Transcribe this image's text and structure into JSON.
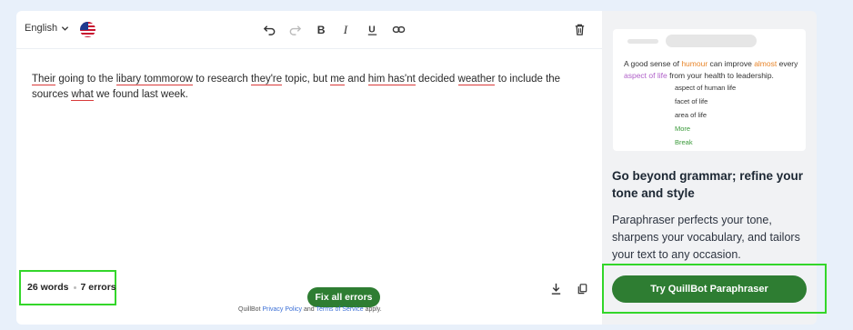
{
  "toolbar": {
    "language": "English",
    "language_flag": "us-flag-icon",
    "icons": [
      "undo-icon",
      "redo-icon",
      "bold-icon",
      "italic-icon",
      "underline-icon",
      "link-icon",
      "trash-icon"
    ]
  },
  "editor": {
    "segments": [
      {
        "text": "Their",
        "error": true
      },
      {
        "text": " going to the ",
        "error": false
      },
      {
        "text": "libary tommorow",
        "error": true
      },
      {
        "text": " to research ",
        "error": false
      },
      {
        "text": "they're",
        "error": true
      },
      {
        "text": " topic, but ",
        "error": false
      },
      {
        "text": "me",
        "error": true
      },
      {
        "text": " and ",
        "error": false
      },
      {
        "text": "him has'nt",
        "error": true
      },
      {
        "text": " decided ",
        "error": false
      },
      {
        "text": "weather",
        "error": true
      },
      {
        "text": " to include the sources ",
        "error": false
      },
      {
        "text": "what",
        "error": true
      },
      {
        "text": " we found last week.",
        "error": false
      }
    ]
  },
  "stats": {
    "words": "26 words",
    "errors": "7 errors"
  },
  "fix_button": "Fix all errors",
  "footer": {
    "prefix": "QuillBot ",
    "privacy": "Privacy Policy",
    "and": " and ",
    "terms": "Terms of Service",
    "suffix": " apply."
  },
  "preview": {
    "line_parts": [
      {
        "text": "A good sense of ",
        "style": "plain"
      },
      {
        "text": "humour",
        "style": "orange"
      },
      {
        "text": " can improve ",
        "style": "plain"
      },
      {
        "text": "almost",
        "style": "orange"
      },
      {
        "text": " every ",
        "style": "plain"
      },
      {
        "text": "aspect of life",
        "style": "purple"
      },
      {
        "text": " from your health to leadership.",
        "style": "plain"
      }
    ],
    "dropdown": [
      {
        "text": "aspect of human life",
        "style": "plain"
      },
      {
        "text": "facet of life",
        "style": "plain"
      },
      {
        "text": "area of life",
        "style": "plain"
      },
      {
        "text": "More",
        "style": "green"
      },
      {
        "text": "Break",
        "style": "green"
      }
    ]
  },
  "promo": {
    "title": "Go beyond grammar; refine your tone and style",
    "description": "Paraphraser perfects your tone, sharpens your vocabulary, and tailors your text to any occasion.",
    "cta": "Try QuillBot Paraphraser"
  },
  "colors": {
    "accent_green": "#2e7d32",
    "highlight_box": "#33d62a",
    "error_underline": "#d93a3a"
  }
}
